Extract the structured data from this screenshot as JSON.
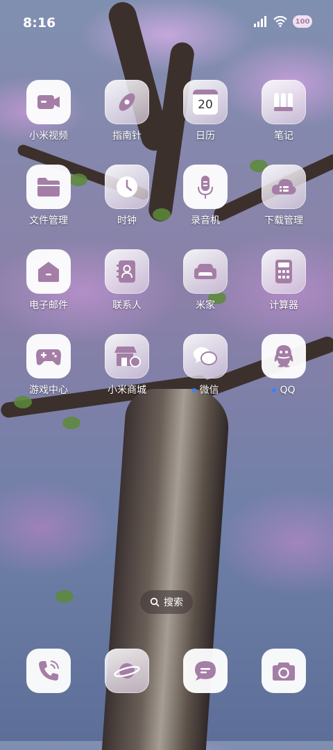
{
  "status": {
    "time": "8:16",
    "battery_label": "100"
  },
  "apps": [
    {
      "label": "小米视频",
      "icon": "video-camera-icon"
    },
    {
      "label": "指南针",
      "icon": "compass-icon"
    },
    {
      "label": "日历",
      "icon": "calendar-icon",
      "day": "20"
    },
    {
      "label": "笔记",
      "icon": "notes-icon"
    },
    {
      "label": "文件管理",
      "icon": "folder-icon"
    },
    {
      "label": "时钟",
      "icon": "clock-icon"
    },
    {
      "label": "录音机",
      "icon": "microphone-icon"
    },
    {
      "label": "下载管理",
      "icon": "download-cloud-icon"
    },
    {
      "label": "电子邮件",
      "icon": "mail-icon"
    },
    {
      "label": "联系人",
      "icon": "contacts-icon"
    },
    {
      "label": "米家",
      "icon": "sofa-icon"
    },
    {
      "label": "计算器",
      "icon": "calculator-icon"
    },
    {
      "label": "游戏中心",
      "icon": "gamepad-icon"
    },
    {
      "label": "小米商城",
      "icon": "store-icon"
    },
    {
      "label": "微信",
      "icon": "wechat-icon"
    },
    {
      "label": "QQ",
      "icon": "qq-icon"
    }
  ],
  "search": {
    "label": "搜索"
  },
  "dock": [
    {
      "icon": "phone-icon"
    },
    {
      "icon": "browser-planet-icon"
    },
    {
      "icon": "messages-icon"
    },
    {
      "icon": "camera-icon"
    }
  ],
  "colors": {
    "accent": "#a47ea6",
    "notification_dot": "#3b82f6"
  }
}
